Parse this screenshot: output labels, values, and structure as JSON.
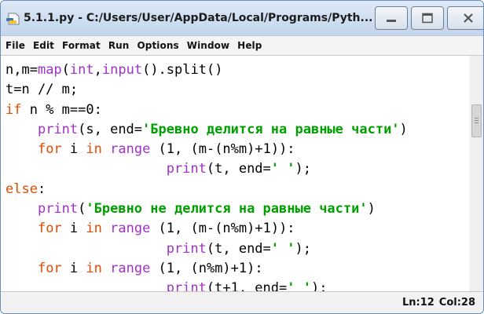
{
  "window": {
    "title": "5.1.1.py - C:/Users/User/AppData/Local/Programs/Pyth...",
    "buttons": [
      "minimize-icon",
      "maximize-icon",
      "close-icon"
    ]
  },
  "menu": [
    "File",
    "Edit",
    "Format",
    "Run",
    "Options",
    "Window",
    "Help"
  ],
  "code": [
    [
      [
        "n,m=",
        "n"
      ],
      [
        "map",
        "bi"
      ],
      [
        "(",
        "n"
      ],
      [
        "int",
        "bi"
      ],
      [
        ",",
        "n"
      ],
      [
        "input",
        "bi"
      ],
      [
        "().split()",
        "n"
      ]
    ],
    [
      [
        "t=n // m;",
        "n"
      ]
    ],
    [
      [
        "if",
        "kw"
      ],
      [
        " n % m==0:",
        "n"
      ]
    ],
    [
      [
        "    ",
        "n"
      ],
      [
        "print",
        "bi"
      ],
      [
        "(s, end=",
        "n"
      ],
      [
        "'Бревно делится на равные части'",
        "str"
      ],
      [
        ")",
        "n"
      ]
    ],
    [
      [
        "    ",
        "n"
      ],
      [
        "for",
        "kw"
      ],
      [
        " i ",
        "n"
      ],
      [
        "in",
        "kw"
      ],
      [
        " ",
        "n"
      ],
      [
        "range",
        "bi"
      ],
      [
        " (1, (m-(n%m)+1)):",
        "n"
      ]
    ],
    [
      [
        "                    ",
        "n"
      ],
      [
        "print",
        "bi"
      ],
      [
        "(t, end=",
        "n"
      ],
      [
        "' '",
        "str"
      ],
      [
        ");",
        "n"
      ]
    ],
    [
      [
        "else",
        "kw"
      ],
      [
        ":",
        "n"
      ]
    ],
    [
      [
        "    ",
        "n"
      ],
      [
        "print",
        "bi"
      ],
      [
        "(",
        "n"
      ],
      [
        "'Бревно не делится на равные части'",
        "str"
      ],
      [
        ")",
        "n"
      ]
    ],
    [
      [
        "    ",
        "n"
      ],
      [
        "for",
        "kw"
      ],
      [
        " i ",
        "n"
      ],
      [
        "in",
        "kw"
      ],
      [
        " ",
        "n"
      ],
      [
        "range",
        "bi"
      ],
      [
        " (1, (m-(n%m)+1)):",
        "n"
      ]
    ],
    [
      [
        "                    ",
        "n"
      ],
      [
        "print",
        "bi"
      ],
      [
        "(t, end=",
        "n"
      ],
      [
        "' '",
        "str"
      ],
      [
        ");",
        "n"
      ]
    ],
    [
      [
        "    ",
        "n"
      ],
      [
        "for",
        "kw"
      ],
      [
        " i ",
        "n"
      ],
      [
        "in",
        "kw"
      ],
      [
        " ",
        "n"
      ],
      [
        "range",
        "bi"
      ],
      [
        " (1, (n%m)+1):",
        "n"
      ]
    ],
    [
      [
        "                    ",
        "n"
      ],
      [
        "print",
        "bi"
      ],
      [
        "(t+1, end=",
        "n"
      ],
      [
        "' '",
        "str"
      ],
      [
        ");",
        "n"
      ]
    ]
  ],
  "status": {
    "line": "Ln:12",
    "col": "Col:28"
  },
  "colors": {
    "keyword": "#e04a00",
    "builtin": "#a030c8",
    "string": "#00a000",
    "titlebar": "#c9daee"
  }
}
